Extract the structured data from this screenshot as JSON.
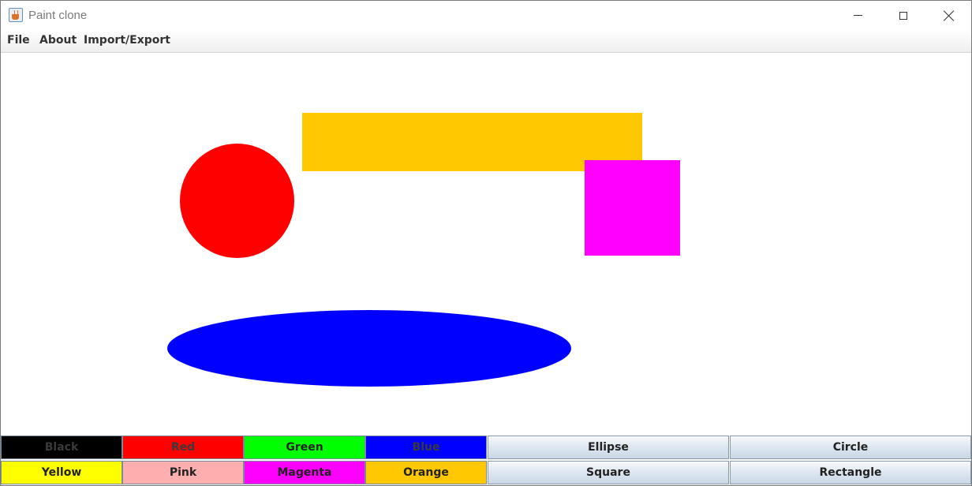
{
  "window": {
    "title": "Paint clone"
  },
  "menu": {
    "items": [
      "File",
      "About",
      "Import/Export"
    ]
  },
  "canvas_shapes": {
    "circle": {
      "color": "#ff0000"
    },
    "rectangle": {
      "color": "#ffc800"
    },
    "square": {
      "color": "#ff00ff"
    },
    "ellipse": {
      "color": "#0000ff"
    }
  },
  "color_buttons": [
    {
      "label": "Black",
      "color": "#000000"
    },
    {
      "label": "Red",
      "color": "#ff0000"
    },
    {
      "label": "Green",
      "color": "#00ff00"
    },
    {
      "label": "Blue",
      "color": "#0000ff"
    },
    {
      "label": "Yellow",
      "color": "#ffff00"
    },
    {
      "label": "Pink",
      "color": "#ffafaf"
    },
    {
      "label": "Magenta",
      "color": "#ff00ff"
    },
    {
      "label": "Orange",
      "color": "#ffc800"
    }
  ],
  "shape_buttons": [
    "Ellipse",
    "Circle",
    "Square",
    "Rectangle"
  ]
}
